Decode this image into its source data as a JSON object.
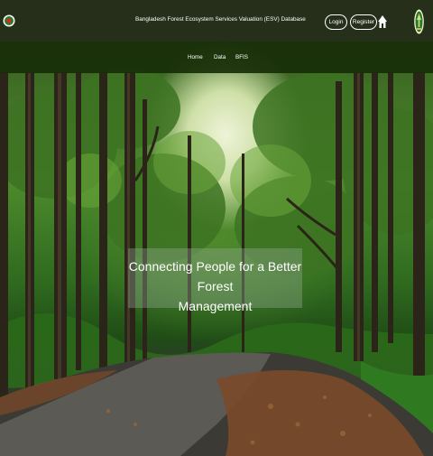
{
  "header": {
    "title": "Bangladesh Forest Ecosystem Services Valuation (ESV) Database",
    "login_label": "Login",
    "register_label": "Register",
    "left_emblem": "bangladesh-government-emblem",
    "home_icon": "home-icon",
    "right_emblem": "forest-department-emblem"
  },
  "nav": {
    "items": [
      {
        "label": "Home"
      },
      {
        "label": "Data"
      },
      {
        "label": "BFIS"
      }
    ]
  },
  "hero": {
    "tagline_line1": "Connecting People for a Better Forest",
    "tagline_line2": "Management"
  },
  "colors": {
    "topbar": "#262f1a",
    "navbar": "#182e08",
    "text": "#ffffff"
  }
}
